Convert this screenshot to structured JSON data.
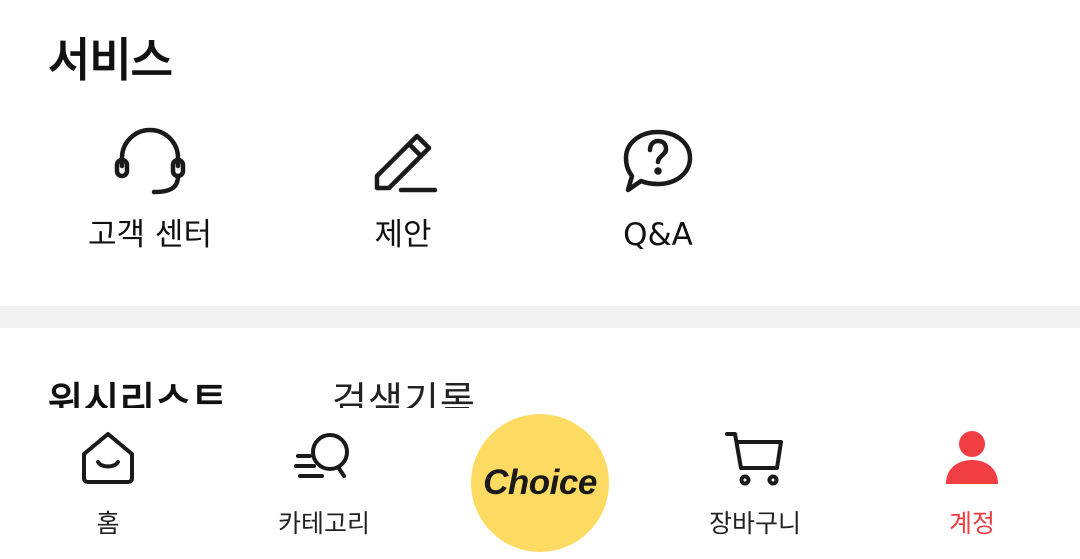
{
  "services": {
    "title": "서비스",
    "items": [
      {
        "label": "고객 센터",
        "icon": "headset-icon"
      },
      {
        "label": "제안",
        "icon": "pencil-icon"
      },
      {
        "label": "Q&A",
        "icon": "question-bubble-icon"
      }
    ]
  },
  "tabs": {
    "wishlist": "위시리스트",
    "history": "검색기록"
  },
  "bottom_nav": {
    "home": "홈",
    "category": "카테고리",
    "choice": "Choice",
    "cart": "장바구니",
    "account": "계정"
  },
  "colors": {
    "accent": "#f03e43",
    "choice_bg": "#fddb63",
    "divider": "#f2f2f2"
  }
}
